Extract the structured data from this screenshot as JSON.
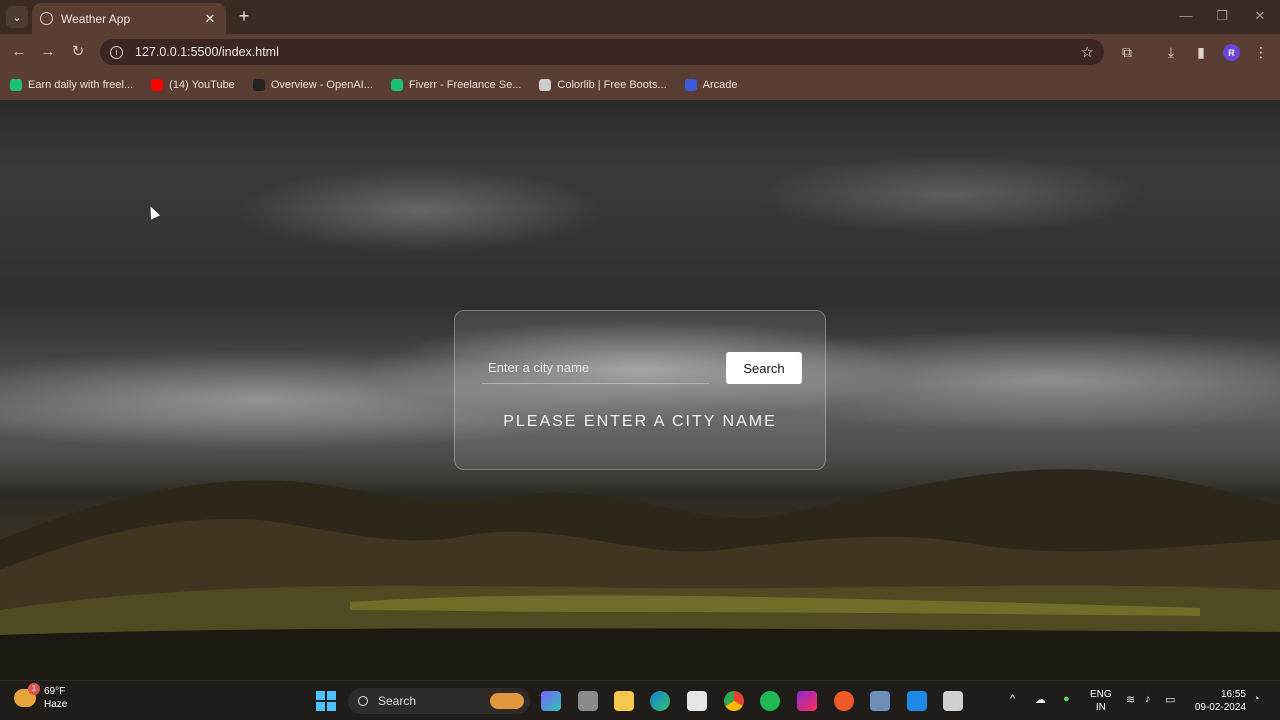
{
  "browser": {
    "tab_title": "Weather App",
    "url": "127.0.0.1:5500/index.html",
    "profile_initial": "R",
    "bookmarks": [
      {
        "label": "Earn daily with freel...",
        "color": "#1dbf73"
      },
      {
        "label": "(14) YouTube",
        "color": "#ff0000"
      },
      {
        "label": "Overview - OpenAI...",
        "color": "#222222"
      },
      {
        "label": "Fiverr - Freelance Se...",
        "color": "#1dbf73"
      },
      {
        "label": "Colorlib | Free Boots...",
        "color": "#cccccc"
      },
      {
        "label": "Arcade",
        "color": "#3b5bdb"
      }
    ]
  },
  "weather_app": {
    "input_placeholder": "Enter a city name",
    "search_label": "Search",
    "message": "PLEASE ENTER A CITY NAME"
  },
  "taskbar": {
    "weather_temp": "69°F",
    "weather_desc": "Haze",
    "weather_badge": "1",
    "search_label": "Search",
    "lang_line1": "ENG",
    "lang_line2": "IN",
    "time": "16:55",
    "date": "09-02-2024"
  }
}
